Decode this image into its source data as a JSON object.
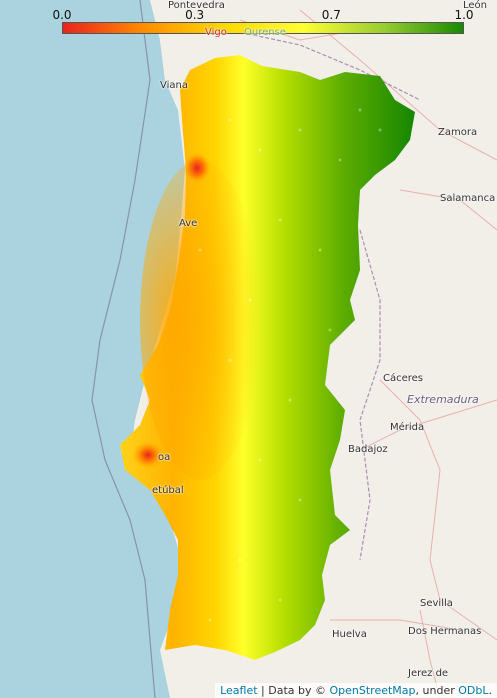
{
  "colorbar": {
    "ticks": [
      "0.0",
      "0.3",
      "0.7",
      "1.0"
    ],
    "tick_values": [
      0.0,
      0.33,
      0.67,
      1.0
    ],
    "colors": [
      "#e8231f",
      "#ff8c00",
      "#ffd700",
      "#ffff33",
      "#9acd32",
      "#1a8a00"
    ]
  },
  "places": {
    "pontevedra": "Pontevedra",
    "leon": "León",
    "vigo": "Vigo",
    "ourense": "Ourense",
    "viana": "Viana",
    "zamora": "Zamora",
    "salamanca": "Salamanca",
    "aveiro": "Ave",
    "caceres": "Cáceres",
    "extremadura": "Extremadura",
    "merida": "Mérida",
    "badajoz": "Badajoz",
    "lisboa": "oa",
    "setubal": "etúbal",
    "sevilla": "Sevilla",
    "dos_hermanas": "Dos Hermanas",
    "huelva": "Huelva",
    "jerez": "Jerez de"
  },
  "attribution": {
    "leaflet": "Leaflet",
    "separator": " | Data by © ",
    "osm": "OpenStreetMap",
    "under": ", under ",
    "odbl": "ODbL",
    "period": "."
  }
}
